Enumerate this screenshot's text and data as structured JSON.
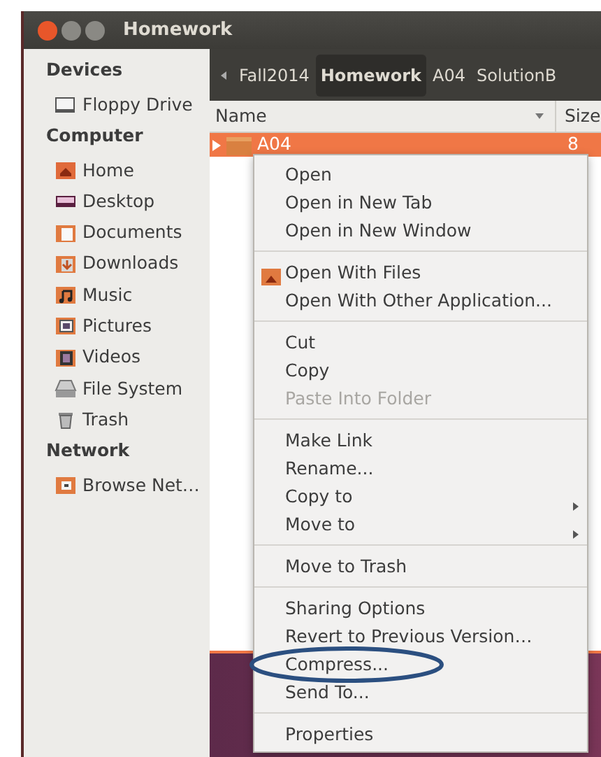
{
  "window": {
    "title": "Homework"
  },
  "sidebar": {
    "sections": [
      {
        "title": "Devices",
        "items": [
          {
            "label": "Floppy Drive",
            "kind": "floppy"
          }
        ]
      },
      {
        "title": "Computer",
        "items": [
          {
            "label": "Home",
            "kind": "home"
          },
          {
            "label": "Desktop",
            "kind": "desktop"
          },
          {
            "label": "Documents",
            "kind": "documents"
          },
          {
            "label": "Downloads",
            "kind": "downloads"
          },
          {
            "label": "Music",
            "kind": "music"
          },
          {
            "label": "Pictures",
            "kind": "pictures"
          },
          {
            "label": "Videos",
            "kind": "videos"
          },
          {
            "label": "File System",
            "kind": "filesystem"
          },
          {
            "label": "Trash",
            "kind": "trash"
          }
        ]
      },
      {
        "title": "Network",
        "items": [
          {
            "label": "Browse Net…",
            "kind": "network"
          }
        ]
      }
    ]
  },
  "breadcrumb": [
    {
      "label": "Fall2014",
      "selected": false
    },
    {
      "label": "Homework",
      "selected": true
    },
    {
      "label": "A04",
      "selected": false
    },
    {
      "label": "SolutionB",
      "selected": false
    }
  ],
  "file_list": {
    "columns": [
      "Name",
      "Size"
    ],
    "rows": [
      {
        "name": "A04",
        "size": "8",
        "selected": true
      }
    ]
  },
  "menu": {
    "groups": [
      {
        "items": [
          {
            "label": "Open",
            "kind": "plain",
            "disabled": false,
            "circled": false
          },
          {
            "label": "Open in New Tab",
            "kind": "plain",
            "disabled": false,
            "circled": false
          },
          {
            "label": "Open in New Window",
            "kind": "plain",
            "disabled": false,
            "circled": false
          }
        ]
      },
      {
        "items": [
          {
            "label": "Open With Files",
            "kind": "icon",
            "disabled": false,
            "circled": false
          },
          {
            "label": "Open With Other Application...",
            "kind": "plain",
            "disabled": false,
            "circled": false
          }
        ]
      },
      {
        "items": [
          {
            "label": "Cut",
            "kind": "plain",
            "disabled": false,
            "circled": false
          },
          {
            "label": "Copy",
            "kind": "plain",
            "disabled": false,
            "circled": false
          },
          {
            "label": "Paste Into Folder",
            "kind": "plain",
            "disabled": true,
            "circled": false
          }
        ]
      },
      {
        "items": [
          {
            "label": "Make Link",
            "kind": "plain",
            "disabled": false,
            "circled": false
          },
          {
            "label": "Rename...",
            "kind": "plain",
            "disabled": false,
            "circled": false
          },
          {
            "label": "Copy to",
            "kind": "submenu",
            "disabled": false,
            "circled": false
          },
          {
            "label": "Move to",
            "kind": "submenu",
            "disabled": false,
            "circled": false
          }
        ]
      },
      {
        "items": [
          {
            "label": "Move to Trash",
            "kind": "plain",
            "disabled": false,
            "circled": false
          }
        ]
      },
      {
        "items": [
          {
            "label": "Sharing Options",
            "kind": "plain",
            "disabled": false,
            "circled": false
          },
          {
            "label": "Revert to Previous Version…",
            "kind": "plain",
            "disabled": false,
            "circled": false
          },
          {
            "label": "Compress...",
            "kind": "plain",
            "disabled": false,
            "circled": true
          },
          {
            "label": "Send To...",
            "kind": "plain",
            "disabled": false,
            "circled": false
          }
        ]
      },
      {
        "items": [
          {
            "label": "Properties",
            "kind": "plain",
            "disabled": false,
            "circled": false
          }
        ]
      }
    ]
  }
}
